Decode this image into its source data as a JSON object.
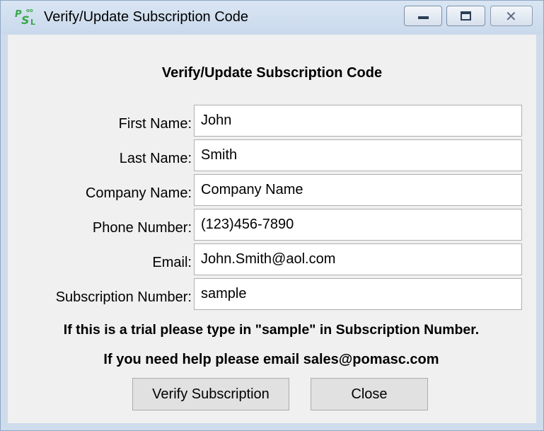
{
  "window": {
    "title": "Verify/Update Subscription Code"
  },
  "dialog": {
    "heading": "Verify/Update Subscription Code",
    "fields": [
      {
        "label": "First Name:",
        "value": "John"
      },
      {
        "label": "Last Name:",
        "value": "Smith"
      },
      {
        "label": "Company Name:",
        "value": "Company Name"
      },
      {
        "label": "Phone Number:",
        "value": "(123)456-7890"
      },
      {
        "label": "Email:",
        "value": "John.Smith@aol.com"
      },
      {
        "label": "Subscription Number:",
        "value": "sample"
      }
    ],
    "trial_note": "If this is a trial please type in \"sample\" in Subscription Number.",
    "help_note": "If you need help please email sales@pomasc.com",
    "verify_label": "Verify Subscription",
    "close_label": "Close"
  },
  "icons": {
    "app": "psl-app-icon",
    "minimize": "minimize-icon",
    "maximize": "maximize-icon",
    "close": "close-icon"
  }
}
